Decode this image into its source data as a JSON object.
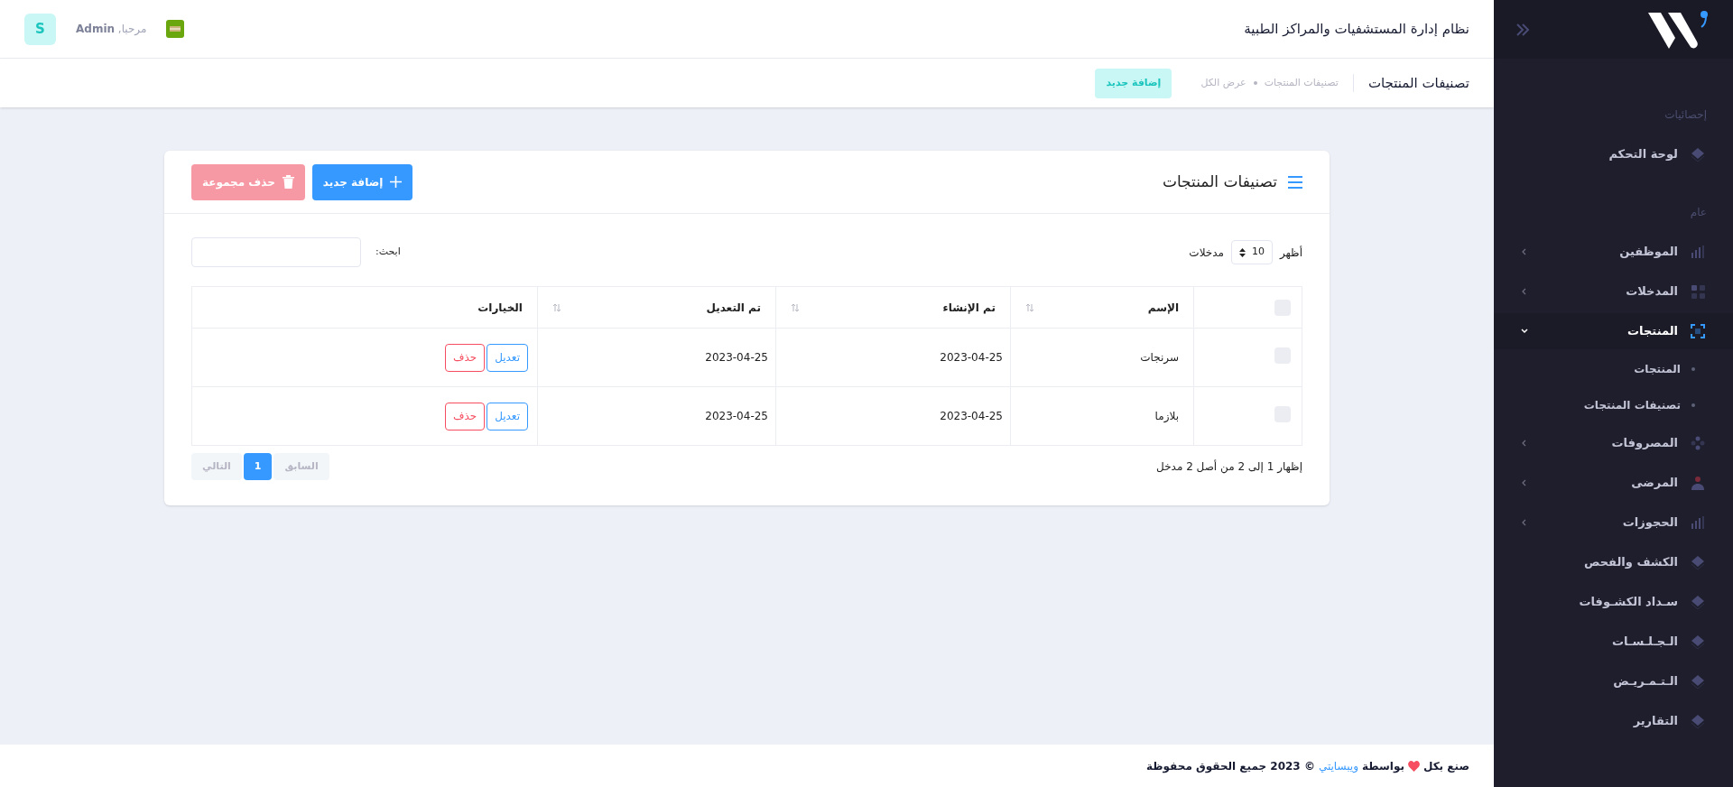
{
  "header": {
    "title": "نظام إدارة المستشفيات والمراكز الطبية",
    "greeting": "مرحبا, **Admin**",
    "avatar": "S"
  },
  "subheader": {
    "title": "تصنيفات المنتجات",
    "breadcrumbs": [
      "تصنيفات المنتجات",
      "عرض الكل"
    ],
    "button": "إضافة جديد"
  },
  "sidebar": {
    "items": [
      {
        "kind": "section",
        "label": "إحصائيات"
      },
      {
        "kind": "link",
        "label": "لوحة التحكم",
        "selected": false
      },
      {
        "kind": "section",
        "label": "عام"
      },
      {
        "kind": "group",
        "label": "الموظفين",
        "selected": false,
        "expanded": false
      },
      {
        "kind": "group",
        "label": "المدخلات",
        "selected": false,
        "expanded": false
      },
      {
        "kind": "group",
        "label": "المنتجات",
        "selected": true,
        "expanded": true,
        "children": [
          {
            "label": "المنتجات"
          },
          {
            "label": "تصنيفات المنتجات"
          }
        ]
      },
      {
        "kind": "group",
        "label": "المصروفات",
        "selected": false,
        "expanded": false
      },
      {
        "kind": "group",
        "label": "المرضى",
        "selected": false,
        "expanded": false
      },
      {
        "kind": "group",
        "label": "الحجوزات",
        "selected": false,
        "expanded": false
      },
      {
        "kind": "link",
        "label": "الكشف والفحص",
        "selected": false
      },
      {
        "kind": "link",
        "label": "سـداد الكشـوفات",
        "selected": false
      },
      {
        "kind": "link",
        "label": "الـجـلـسـات",
        "selected": false
      },
      {
        "kind": "link",
        "label": "الـتـمـريـض",
        "selected": false
      },
      {
        "kind": "link",
        "label": "التقارير",
        "selected": false
      }
    ]
  },
  "card": {
    "title": "تصنيفات المنتجات",
    "add_button": "إضافة جديد",
    "bulk_delete_button": "حذف مجموعة",
    "length": {
      "before": "أظهر",
      "value": "10",
      "after": "مدخلات"
    },
    "search": {
      "label": "ابحث:"
    },
    "table": {
      "header_checkbox": {
        "checked": false
      },
      "columns": [
        "الإسم",
        "تم الإنشاء",
        "تم التعديل",
        "الخيارات"
      ],
      "rows": [
        {
          "checked": false,
          "name": "سرنجات",
          "created": "2023-04-25",
          "modified": "2023-04-25",
          "edit": "تعديل",
          "delete": "حذف"
        },
        {
          "checked": false,
          "name": "بلازما",
          "created": "2023-04-25",
          "modified": "2023-04-25",
          "edit": "تعديل",
          "delete": "حذف"
        }
      ]
    },
    "info": "إظهار 1 إلى 2 من أصل 2 مدخل",
    "pagination": [
      {
        "label": "السابق",
        "selected": false,
        "disabled": true
      },
      {
        "label": "1",
        "selected": true,
        "disabled": false
      },
      {
        "label": "التالي",
        "selected": false,
        "disabled": true
      }
    ]
  },
  "footer": {
    "before": "صنع بكل",
    "by": "بواسطة",
    "link": "ويبسايتي",
    "after": "© 2023 جميع الحقوق محفوظة"
  }
}
